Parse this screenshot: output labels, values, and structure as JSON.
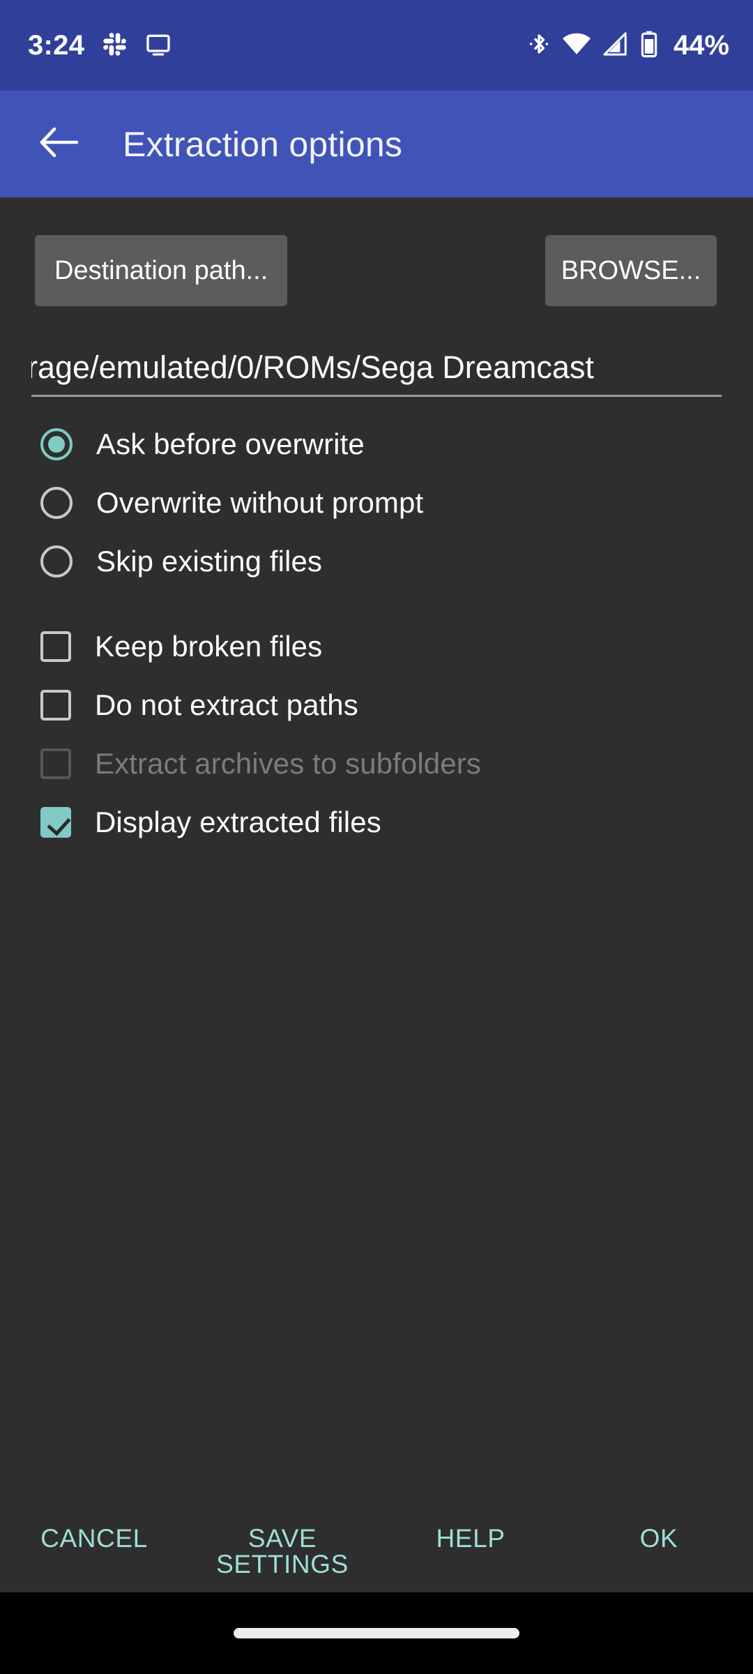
{
  "status_bar": {
    "time": "3:24",
    "battery_percent": "44%",
    "icons": [
      "slack-icon",
      "cast-screen-icon",
      "bluetooth-icon",
      "wifi-icon",
      "cellular-signal-icon",
      "battery-icon"
    ],
    "background_color": "#30409a"
  },
  "app_bar": {
    "back_icon": "arrow-left-icon",
    "title": "Extraction options",
    "background_color": "#4054b8"
  },
  "main": {
    "destination_button_label": "Destination path...",
    "browse_button_label": "BROWSE...",
    "path_value": "rage/emulated/0/ROMs/Sega Dreamcast",
    "overwrite_options": [
      {
        "label": "Ask before overwrite",
        "selected": true
      },
      {
        "label": "Overwrite without prompt",
        "selected": false
      },
      {
        "label": "Skip existing files",
        "selected": false
      }
    ],
    "checkbox_options": [
      {
        "label": "Keep broken files",
        "checked": false,
        "disabled": false
      },
      {
        "label": "Do not extract paths",
        "checked": false,
        "disabled": false
      },
      {
        "label": "Extract archives to subfolders",
        "checked": false,
        "disabled": true
      },
      {
        "label": "Display extracted files",
        "checked": true,
        "disabled": false
      }
    ],
    "accent_color": "#80cbc4",
    "background_color": "#2e2e2e"
  },
  "bottom_bar": {
    "buttons": [
      {
        "line1": "CANCEL",
        "line2": ""
      },
      {
        "line1": "SAVE",
        "line2": "SETTINGS"
      },
      {
        "line1": "HELP",
        "line2": ""
      },
      {
        "line1": "OK",
        "line2": ""
      }
    ],
    "text_color": "#9edfd6"
  },
  "nav_bar": {
    "gesture_pill": "home-gesture-pill"
  }
}
